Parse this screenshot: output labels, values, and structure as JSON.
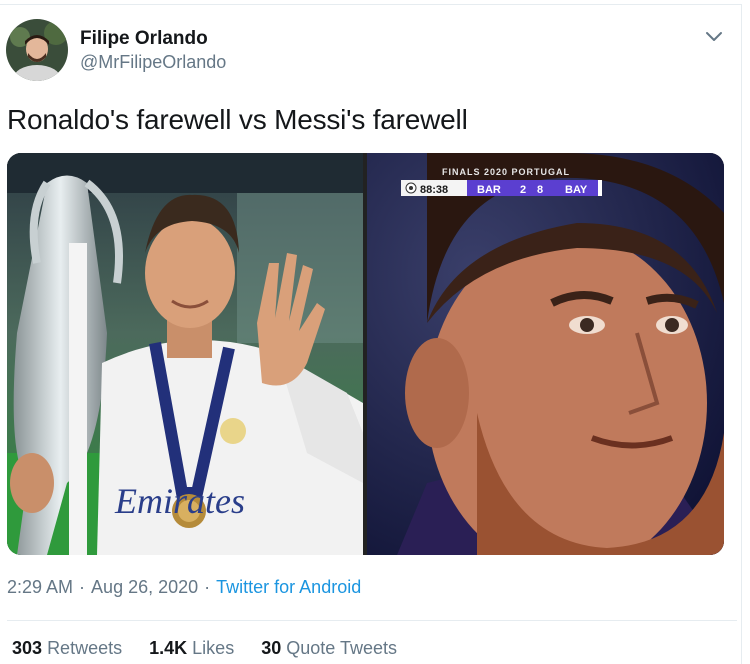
{
  "author": {
    "name": "Filipe Orlando",
    "handle": "@MrFilipeOrlando"
  },
  "tweet": {
    "text": "Ronaldo's farewell vs Messi's farewell"
  },
  "media": {
    "scoreboard": {
      "banner": "FINALS 2020 PORTUGAL",
      "clock": "88:38",
      "home_team": "BAR",
      "home_score": "2",
      "away_score": "8",
      "away_team": "BAY"
    },
    "shirt_sponsor": "Emirates"
  },
  "meta": {
    "time": "2:29 AM",
    "date": "Aug 26, 2020",
    "separator": "·",
    "source": "Twitter for Android"
  },
  "stats": {
    "retweets_count": "303",
    "retweets_label": "Retweets",
    "likes_count": "1.4K",
    "likes_label": "Likes",
    "quotes_count": "30",
    "quotes_label": "Quote Tweets"
  },
  "colors": {
    "link": "#1b95e0",
    "secondary_text": "#657786",
    "scoreboard_team_bg": "#5b3fd0"
  },
  "icons": {
    "menu": "chevron-down-icon",
    "ball": "soccer-ball-icon"
  }
}
